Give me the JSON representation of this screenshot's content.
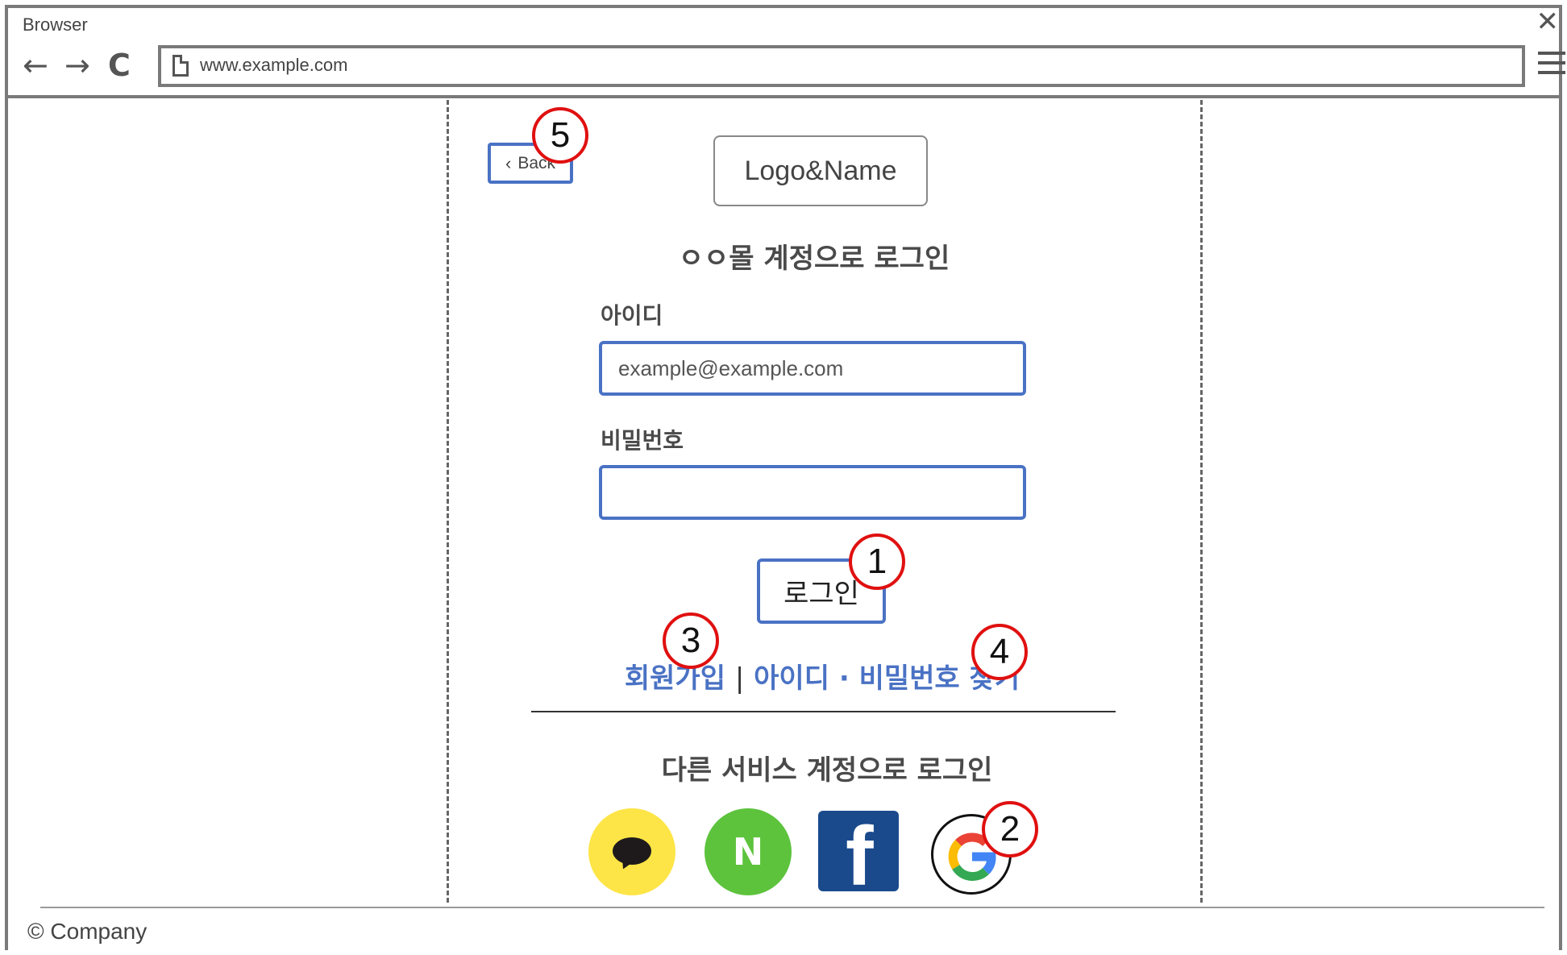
{
  "browser": {
    "title": "Browser",
    "url": "www.example.com",
    "back_icon": "←",
    "forward_icon": "→",
    "reload_icon": "C",
    "close_icon": "✕"
  },
  "page": {
    "back_label": "Back",
    "logo_label": "Logo&Name",
    "login_title": "ㅇㅇ몰 계정으로 로그인",
    "id_label": "아이디",
    "id_placeholder": "example@example.com",
    "password_label": "비밀번호",
    "password_value": "",
    "login_button": "로그인",
    "links": {
      "signup": "회원가입",
      "separator": "|",
      "find": "아이디 · 비밀번호 찾기"
    },
    "other_login_title": "다른 서비스 계정으로 로그인",
    "social": {
      "naver_letter": "N",
      "facebook_letter": "f",
      "colors": {
        "kakao": "#fde547",
        "naver": "#5dc33d",
        "facebook": "#1b4a8c"
      }
    }
  },
  "footer": {
    "text": "© Company"
  },
  "annotations": [
    "1",
    "2",
    "3",
    "4",
    "5"
  ],
  "colors": {
    "accent": "#4a72c4",
    "annotation": "#e01010"
  }
}
